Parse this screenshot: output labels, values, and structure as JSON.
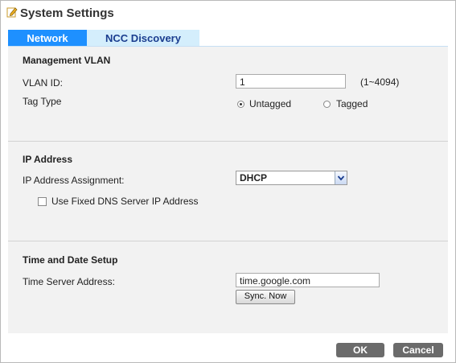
{
  "window": {
    "title": "System Settings",
    "icon": "edit-icon"
  },
  "tabs": [
    {
      "label": "Network",
      "active": true
    },
    {
      "label": "NCC Discovery",
      "active": false
    }
  ],
  "management_vlan": {
    "heading": "Management VLAN",
    "vlan_id_label": "VLAN ID:",
    "vlan_id_value": "1",
    "vlan_range_hint": "(1~4094)",
    "tag_type_label": "Tag Type",
    "untagged_label": "Untagged",
    "tagged_label": "Tagged",
    "selected": "Untagged"
  },
  "ip_address": {
    "heading": "IP Address",
    "assignment_label": "IP Address Assignment:",
    "assignment_value": "DHCP",
    "fixed_dns_label": "Use Fixed DNS Server IP Address",
    "fixed_dns_checked": false
  },
  "time_date": {
    "heading": "Time and Date Setup",
    "server_label": "Time Server Address:",
    "server_value": "time.google.com",
    "sync_label": "Sync. Now"
  },
  "footer": {
    "ok_label": "OK",
    "cancel_label": "Cancel"
  },
  "colors": {
    "active_tab": "#1e90ff",
    "inactive_tab": "#d4eefc",
    "panel_bg": "#f2f2f2",
    "button_bg": "#6b6b6b"
  }
}
